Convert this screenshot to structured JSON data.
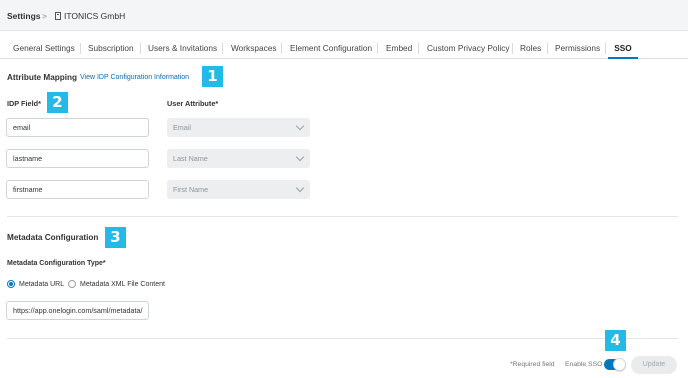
{
  "breadcrumb": {
    "root": "Settings",
    "separator": ">",
    "org": "ITONICS GmbH"
  },
  "tabs": [
    {
      "label": "General Settings"
    },
    {
      "label": "Subscription"
    },
    {
      "label": "Users & Invitations"
    },
    {
      "label": "Workspaces"
    },
    {
      "label": "Element Configuration"
    },
    {
      "label": "Embed"
    },
    {
      "label": "Custom Privacy Policy"
    },
    {
      "label": "Roles"
    },
    {
      "label": "Permissions"
    },
    {
      "label": "SSO",
      "active": true
    }
  ],
  "attribute_mapping": {
    "title": "Attribute Mapping",
    "link": "View IDP Configuration Information",
    "idp_header": "IDP Field*",
    "user_header": "User Attribute*",
    "rows": [
      {
        "idp_value": "email",
        "user_value": "Email"
      },
      {
        "idp_value": "lastname",
        "user_value": "Last Name"
      },
      {
        "idp_value": "firstname",
        "user_value": "First Name"
      }
    ]
  },
  "metadata": {
    "title": "Metadata Configuration",
    "type_label": "Metadata Configuration Type*",
    "options": [
      {
        "label": "Metadata URL",
        "checked": true
      },
      {
        "label": "Metadata XML File Content",
        "checked": false
      }
    ],
    "url_value": "https://app.onelogin.com/saml/metadata/"
  },
  "footer": {
    "required_note": "*Required field",
    "enable_label": "Enable SSO",
    "enabled": true,
    "update_label": "Update"
  },
  "badges": [
    "1",
    "2",
    "3",
    "4"
  ],
  "colors": {
    "accent": "#0079c1",
    "badge": "#24b9e6",
    "link": "#0a6ab5"
  }
}
